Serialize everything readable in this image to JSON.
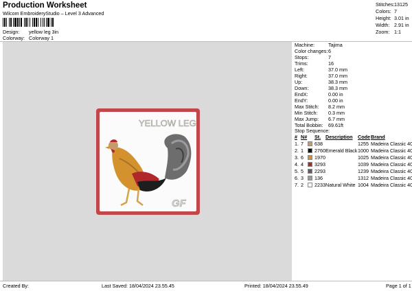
{
  "header": {
    "title": "Production Worksheet",
    "subtitle": "Wilcom EmbroideryStudio – Level 3 Advanced",
    "design_label": "Design:",
    "design_value": "yellow leg 3in",
    "colorway_label": "Colorway:",
    "colorway_value": "Colorway 1"
  },
  "top_stats": [
    {
      "label": "Stitches:",
      "value": "13125"
    },
    {
      "label": "Colors:",
      "value": "7"
    },
    {
      "label": "Height:",
      "value": "3.01 in"
    },
    {
      "label": "Width:",
      "value": "2.91 in"
    },
    {
      "label": "Zoom:",
      "value": "1:1"
    }
  ],
  "design_properties": [
    {
      "label": "Machine:",
      "value": "Tajima"
    },
    {
      "label": "Color changes:",
      "value": "6"
    },
    {
      "label": "Stops:",
      "value": "7"
    },
    {
      "label": "Trims:",
      "value": "16"
    },
    {
      "label": "Left:",
      "value": "37.0 mm"
    },
    {
      "label": "Right:",
      "value": "37.0 mm"
    },
    {
      "label": "Up:",
      "value": "38.3 mm"
    },
    {
      "label": "Down:",
      "value": "38.3 mm"
    },
    {
      "label": "EndX:",
      "value": "0.00 in"
    },
    {
      "label": "EndY:",
      "value": "0.00 in"
    },
    {
      "label": "Max Stitch:",
      "value": "8.2 mm"
    },
    {
      "label": "Min Stitch:",
      "value": "0.3 mm"
    },
    {
      "label": "Max Jump:",
      "value": "6.7 mm"
    },
    {
      "label": "Total Bobbin:",
      "value": "69.61ft"
    }
  ],
  "stop_sequence": {
    "title": "Stop Sequence:",
    "columns": {
      "num": "#",
      "n": "N#",
      "st": "St.",
      "description": "Description",
      "code": "Code",
      "brand": "Brand"
    },
    "rows": [
      {
        "num": "1.",
        "n": "7",
        "color": "#c89a6a",
        "st": "638",
        "description": "",
        "code": "1255",
        "brand": "Madeira Classic 40"
      },
      {
        "num": "2.",
        "n": "1",
        "color": "#111111",
        "st": "2760",
        "description": "Emerald Black",
        "code": "1000",
        "brand": "Madeira Classic 40"
      },
      {
        "num": "3.",
        "n": "6",
        "color": "#d4922e",
        "st": "1970",
        "description": "",
        "code": "1025",
        "brand": "Madeira Classic 40"
      },
      {
        "num": "4.",
        "n": "4",
        "color": "#b0282c",
        "st": "3293",
        "description": "",
        "code": "1039",
        "brand": "Madeira Classic 40"
      },
      {
        "num": "5.",
        "n": "5",
        "color": "#5e5e5e",
        "st": "2293",
        "description": "",
        "code": "1239",
        "brand": "Madeira Classic 40"
      },
      {
        "num": "6.",
        "n": "3",
        "color": "#9a9aa2",
        "st": "136",
        "description": "",
        "code": "1312",
        "brand": "Madeira Classic 40"
      },
      {
        "num": "7.",
        "n": "2",
        "color": "#f6f6f2",
        "st": "2233",
        "description": "Natural White",
        "code": "1004",
        "brand": "Madeira Classic 40"
      }
    ]
  },
  "artwork": {
    "caption": "YELLOW LEG",
    "monogram": "GF",
    "border_color": "#c2474a",
    "panel_color": "#fbfbfb"
  },
  "footer": {
    "created_by": "Created By:",
    "last_saved": "Last Saved: 18/04/2024 23.55.45",
    "printed": "Printed: 18/04/2024 23.55.49",
    "page": "Page 1 of 1"
  }
}
